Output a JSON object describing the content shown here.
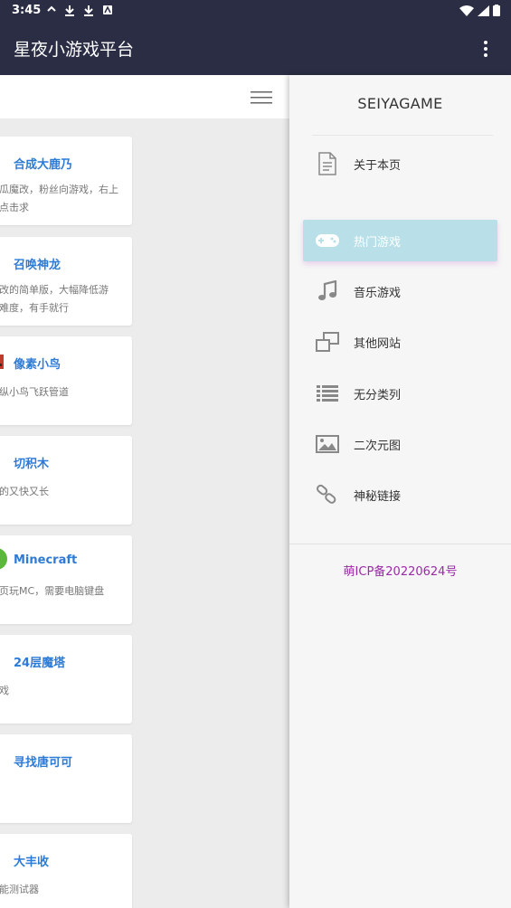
{
  "status_bar": {
    "time": "3:45"
  },
  "app_bar": {
    "title": "星夜小游戏平台"
  },
  "games": [
    {
      "title": "合成大鹿乃",
      "desc": "西瓜魔改，粉丝向游戏，右上\n角点击求"
    },
    {
      "title": "召唤神龙",
      "desc": "修改的简单版，大幅降低游\n戏难度，有手就行"
    },
    {
      "title": "像素小鸟",
      "desc": "操纵小鸟飞跃管道"
    },
    {
      "title": "切积木",
      "desc": "切的又快又长"
    },
    {
      "title": "Minecraft",
      "desc": "网页玩MC，需要电脑键盘"
    },
    {
      "title": "24层魔塔",
      "desc": "游戏"
    },
    {
      "title": "寻找唐可可",
      "desc": ""
    },
    {
      "title": "大丰收",
      "desc": "性能测试器"
    }
  ],
  "drawer": {
    "title": "SEIYAGAME",
    "items": [
      {
        "label": "关于本页",
        "icon": "document-icon"
      },
      {
        "label": "热门游戏",
        "icon": "gamepad-icon"
      },
      {
        "label": "音乐游戏",
        "icon": "music-note-icon"
      },
      {
        "label": "其他网站",
        "icon": "windows-icon"
      },
      {
        "label": "无分类列",
        "icon": "list-icon"
      },
      {
        "label": "二次元图",
        "icon": "image-icon"
      },
      {
        "label": "神秘链接",
        "icon": "link-icon"
      }
    ],
    "footer": "萌ICP备20220624号"
  },
  "colors": {
    "app_bar": "#2a2d44",
    "card_title": "#2e7bd6",
    "active_item": "#b9e0e8",
    "icp": "#9b2aa8"
  }
}
